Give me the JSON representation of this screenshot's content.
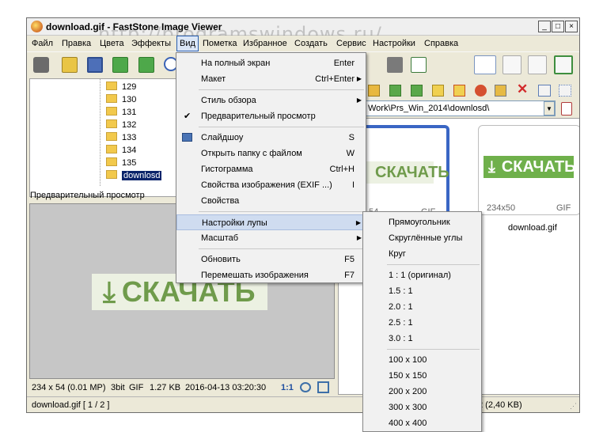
{
  "title": "download.gif  -  FastStone Image Viewer",
  "watermark": "http://programswindows.ru/",
  "window_buttons": [
    "_",
    "□",
    "×"
  ],
  "menubar": [
    "Файл",
    "Правка",
    "Цвета",
    "Эффекты",
    "Вид",
    "Пометка",
    "Избранное",
    "Создать",
    "Сервис",
    "Настройки",
    "Справка"
  ],
  "active_menu": "Вид",
  "tree": {
    "items": [
      "129",
      "130",
      "131",
      "132",
      "133",
      "134",
      "135",
      "downlosd"
    ],
    "selected": "downlosd"
  },
  "preview_label": "Предварительный просмотр",
  "preview_image_text": "СКАЧАТЬ",
  "preview_status": {
    "dims": "234 x 54 (0.01 MP)",
    "bits": "3bit",
    "format": "GIF",
    "size": "1.27 KB",
    "date": "2016-04-13 03:20:30",
    "zoom": "1:1"
  },
  "path": "Work\\Prs_Win_2014\\downlosd\\",
  "thumbnails": [
    {
      "image_text": "СКАЧАТЬ",
      "dims": "54",
      "format": "GIF",
      "selected": true
    },
    {
      "image_text": "СКАЧАТЬ",
      "dims": "234x50",
      "format": "GIF",
      "selected": false,
      "filename": "download.gif"
    }
  ],
  "statusbar": {
    "left": "download.gif [ 1 / 2 ]",
    "right": "2 (2,40 KB)",
    "right_prefix": "I"
  },
  "view_menu": {
    "items": [
      {
        "label": "На полный экран",
        "shortcut": "Enter"
      },
      {
        "label": "Макет",
        "shortcut": "Ctrl+Enter",
        "submenu": true
      },
      {
        "separator": true
      },
      {
        "label": "Стиль обзора",
        "submenu": true
      },
      {
        "label": "Предварительный просмотр",
        "checked": true
      },
      {
        "separator": true
      },
      {
        "label": "Слайдшоу",
        "shortcut": "S",
        "icon": true
      },
      {
        "label": "Открыть папку с файлом",
        "shortcut": "W"
      },
      {
        "label": "Гистограмма",
        "shortcut": "Ctrl+H"
      },
      {
        "label": "Свойства изображения (EXIF ...)",
        "shortcut": "I"
      },
      {
        "label": "Свойства"
      },
      {
        "separator": true
      },
      {
        "label": "Настройки лупы",
        "submenu": true,
        "highlighted": true
      },
      {
        "label": "Масштаб",
        "submenu": true
      },
      {
        "separator": true
      },
      {
        "label": "Обновить",
        "shortcut": "F5"
      },
      {
        "label": "Перемешать изображения",
        "shortcut": "F7"
      }
    ]
  },
  "loupe_submenu": {
    "items": [
      {
        "label": "Прямоугольник"
      },
      {
        "label": "Скруглённые углы"
      },
      {
        "label": "Круг"
      },
      {
        "separator": true
      },
      {
        "label": "1 : 1 (оригинал)"
      },
      {
        "label": "1.5 : 1"
      },
      {
        "label": "2.0 : 1"
      },
      {
        "label": "2.5 : 1"
      },
      {
        "label": "3.0 : 1"
      },
      {
        "separator": true
      },
      {
        "label": "100 x 100"
      },
      {
        "label": "150 x 150"
      },
      {
        "label": "200 x 200"
      },
      {
        "label": "300 x 300"
      },
      {
        "label": "400 x 400"
      }
    ]
  },
  "colors": {
    "accent_green": "#6f9b4b",
    "selection_blue": "#0a246a",
    "thumb_border": "#3a66c4",
    "menu_bg": "#f1f1f1"
  }
}
